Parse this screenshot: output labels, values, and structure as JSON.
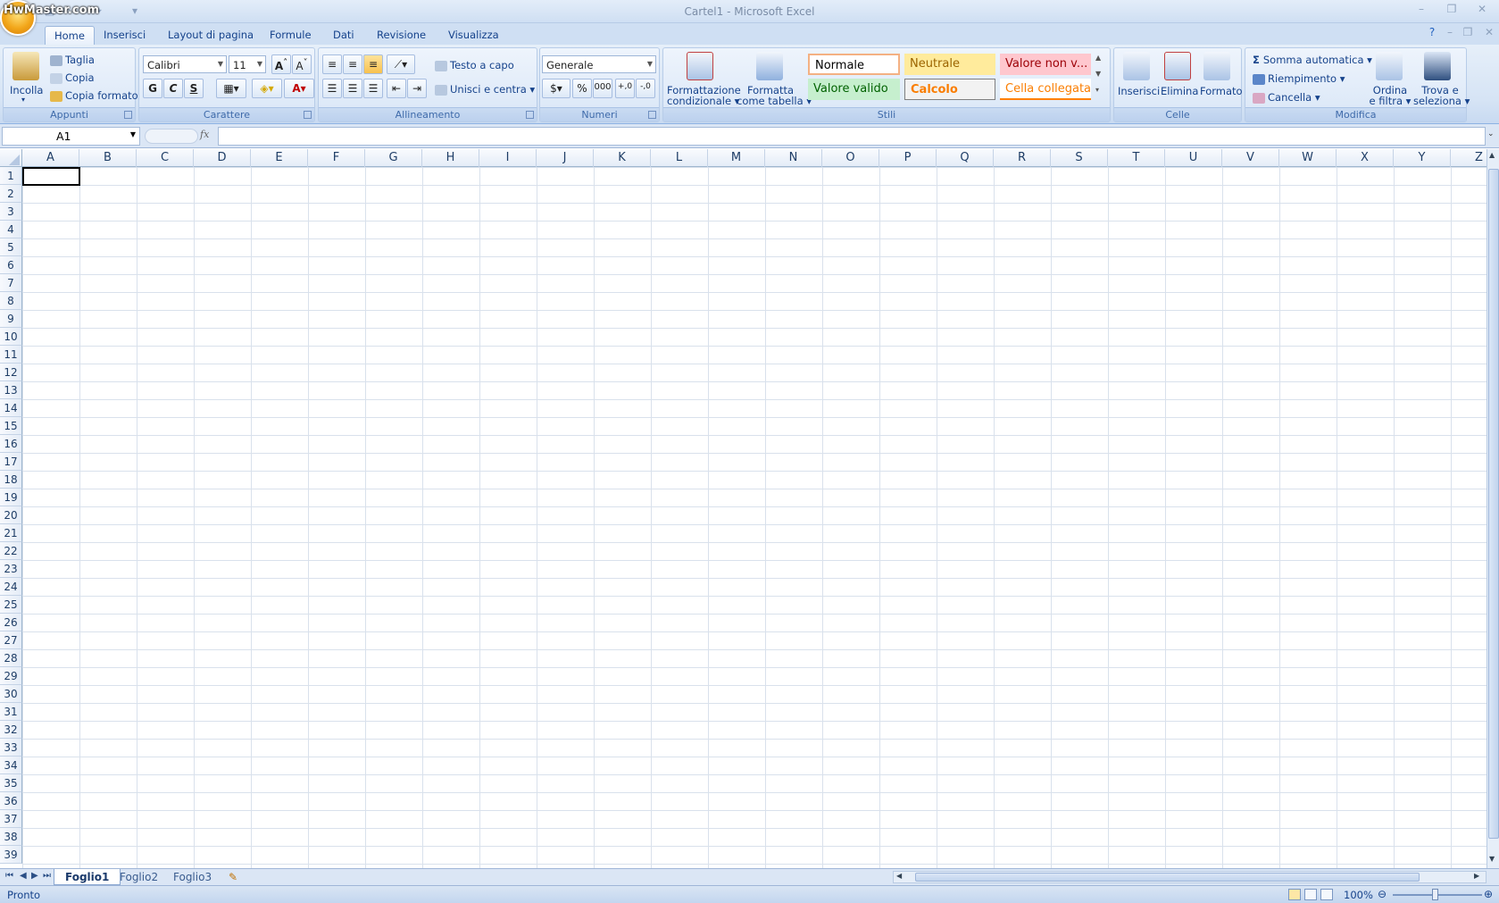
{
  "window": {
    "title": "Cartel1 - Microsoft Excel",
    "watermark": "HwMaster.com"
  },
  "ribbon_tabs": [
    "Home",
    "Inserisci",
    "Layout di pagina",
    "Formule",
    "Dati",
    "Revisione",
    "Visualizza"
  ],
  "clipboard": {
    "paste": "Incolla",
    "cut": "Taglia",
    "copy": "Copia",
    "format_painter": "Copia formato",
    "group": "Appunti"
  },
  "font": {
    "name": "Calibri",
    "size": "11",
    "bold": "G",
    "italic": "C",
    "underline": "S",
    "group": "Carattere"
  },
  "alignment": {
    "wrap_text": "Testo a capo",
    "merge_center": "Unisci e centra",
    "group": "Allineamento"
  },
  "number": {
    "format": "Generale",
    "percent": "%",
    "thousands": "000",
    "group": "Numeri"
  },
  "styles": {
    "conditional_1": "Formattazione",
    "conditional_2": "condizionale",
    "table_1": "Formatta",
    "table_2": "come tabella",
    "normal": "Normale",
    "neutral": "Neutrale",
    "bad": "Valore non v...",
    "good": "Valore valido",
    "calc": "Calcolo",
    "linked": "Cella collegata",
    "group": "Stili"
  },
  "cells_group": {
    "insert": "Inserisci",
    "delete": "Elimina",
    "format": "Formato",
    "group": "Celle"
  },
  "editing": {
    "autosum": "Somma automatica",
    "fill": "Riempimento",
    "clear": "Cancella",
    "sort_1": "Ordina",
    "sort_2": "e filtra",
    "find_1": "Trova e",
    "find_2": "seleziona",
    "group": "Modifica"
  },
  "formula_bar": {
    "name_box": "A1",
    "fx": "fx",
    "value": ""
  },
  "columns": [
    "A",
    "B",
    "C",
    "D",
    "E",
    "F",
    "G",
    "H",
    "I",
    "J",
    "K",
    "L",
    "M",
    "N",
    "O",
    "P",
    "Q",
    "R",
    "S",
    "T",
    "U",
    "V",
    "W",
    "X",
    "Y",
    "Z"
  ],
  "rows": [
    "1",
    "2",
    "3",
    "4",
    "5",
    "6",
    "7",
    "8",
    "9",
    "10",
    "11",
    "12",
    "13",
    "14",
    "15",
    "16",
    "17",
    "18",
    "19",
    "20",
    "21",
    "22",
    "23",
    "24",
    "25",
    "26",
    "27",
    "28",
    "29",
    "30",
    "31",
    "32",
    "33",
    "34",
    "35",
    "36",
    "37",
    "38",
    "39"
  ],
  "sheets": [
    "Foglio1",
    "Foglio2",
    "Foglio3"
  ],
  "active_sheet": "Foglio1",
  "status": {
    "text": "Pronto",
    "zoom": "100%"
  },
  "colors": {
    "ribbon_bg": "#d6e4f5",
    "accent": "#15428b",
    "normal_border": "#f4b183",
    "neutral_bg": "#ffeb9c",
    "bad_bg": "#ffc7ce",
    "good_bg": "#c6efce"
  }
}
